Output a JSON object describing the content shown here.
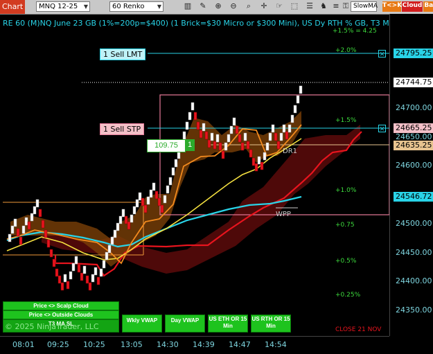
{
  "toolbar": {
    "chart_tab": "Chart",
    "instrument": "MNQ 12-25",
    "bar_type": "60 Renko",
    "indicator": "SlowMA",
    "tc_label": "T<>K",
    "cloud_label": "Cloud",
    "bar_label": "Bar",
    "icons": [
      "bars-icon",
      "pencil-icon",
      "zoom-in-icon",
      "zoom-out-icon",
      "magnifier-icon",
      "crosshair-icon",
      "hand-icon",
      "select-icon",
      "properties-icon",
      "strategy-icon",
      "list-icon",
      "lock-icon",
      "template-icon",
      "scroll-icon"
    ]
  },
  "chart": {
    "title": "RE 60 (M)NQ June 23 GB (1%=200p=$400) (1 Brick=$30 Micro or $300 Mini), US Dy RTH % GB, T3 MA SL",
    "copyright": "© 2025 NinjaTrader, LLC",
    "close_label": "CLOSE 21 NOV",
    "percent_levels": [
      "+2.0%",
      "+1.5%",
      "+1.0%",
      "+0.75",
      "+0.5%",
      "+0.25%"
    ],
    "pct_top_overlap": "+1.5% = 4.25",
    "annotation_dr1": "DR1",
    "annotation_wpp": "WPP",
    "counter_value": "109.75",
    "counter_badge": "1"
  },
  "orders": {
    "sell_limit": "1 Sell LMT",
    "sell_stop": "1 Sell STP"
  },
  "price_axis": {
    "ticks": [
      "24700.00",
      "24650.00",
      "24600.00",
      "24500.00",
      "24450.00",
      "24400.00",
      "24350.00"
    ],
    "markers": [
      {
        "value": "24795.25",
        "color": "#29d4e8"
      },
      {
        "value": "24744.75",
        "color": "#ffffff"
      },
      {
        "value": "24665.25",
        "color": "#f4c0c8"
      },
      {
        "value": "24635.25",
        "color": "#e8c490"
      },
      {
        "value": "24546.72",
        "color": "#29d4e8"
      }
    ]
  },
  "time_axis": [
    "08:01",
    "09:25",
    "10:25",
    "13:05",
    "14:30",
    "14:39",
    "14:47",
    "14:54"
  ],
  "buttons": {
    "scalp_cloud": "Price <> Scalp Cloud",
    "outside_clouds": "Price <> Outside Clouds",
    "t3_ma_sl": "T3 MA SL",
    "wkly_vwap": "Wkly VWAP",
    "day_vwap": "Day VWAP",
    "us_eth": "US ETH OR 15 Min",
    "us_rth": "US RTH OR 15 Min"
  }
}
